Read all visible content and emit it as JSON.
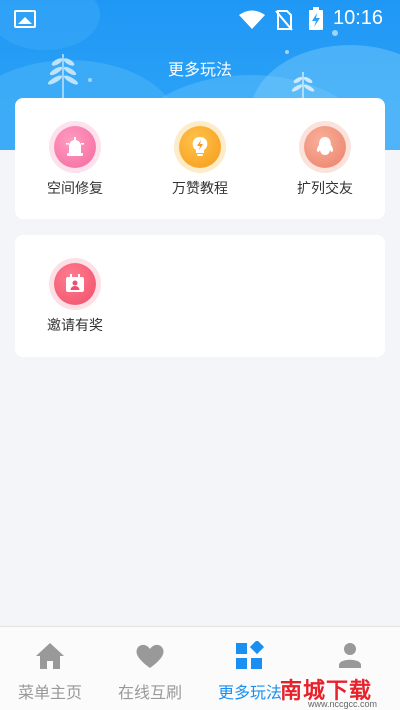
{
  "status_bar": {
    "time": "10:16",
    "icons": [
      "image-icon",
      "wifi-icon",
      "no-sim-icon",
      "battery-charging-icon"
    ]
  },
  "header": {
    "title": "更多玩法"
  },
  "cards": [
    {
      "items": [
        {
          "label": "空间修复",
          "icon": "siren-icon",
          "color": "#f46ba1"
        },
        {
          "label": "万赞教程",
          "icon": "bulb-icon",
          "color": "#f7a21e"
        },
        {
          "label": "扩列交友",
          "icon": "qq-penguin-icon",
          "color": "#ed836c"
        }
      ]
    },
    {
      "items": [
        {
          "label": "邀请有奖",
          "icon": "calendar-user-icon",
          "color": "#f0546e"
        }
      ]
    }
  ],
  "bottom_nav": {
    "items": [
      {
        "label": "菜单主页",
        "icon": "home-icon",
        "active": false
      },
      {
        "label": "在线互刷",
        "icon": "heart-icon",
        "active": false
      },
      {
        "label": "更多玩法",
        "icon": "grid-diamond-icon",
        "active": true
      },
      {
        "label": "",
        "icon": "user-icon",
        "active": false
      }
    ],
    "active_color": "#1a8ff2",
    "inactive_color": "#999999"
  },
  "watermark": {
    "text": "南城下载",
    "url": "www.nccgcc.com"
  }
}
